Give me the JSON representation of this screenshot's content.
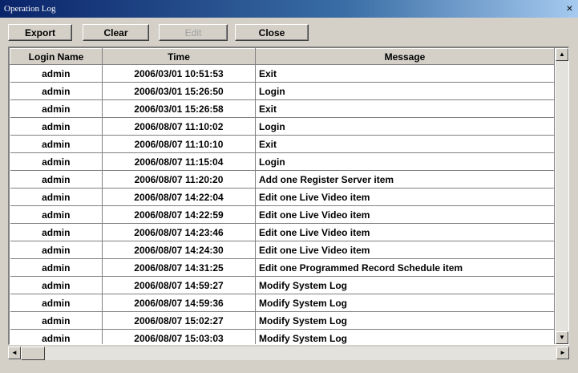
{
  "window": {
    "title": "Operation Log",
    "close_glyph": "×"
  },
  "toolbar": {
    "export_label": "Export",
    "clear_label": "Clear",
    "edit_label": "Edit",
    "close_label": "Close"
  },
  "table": {
    "headers": [
      "Login Name",
      "Time",
      "Message"
    ],
    "rows": [
      [
        "admin",
        "2006/03/01 10:51:53",
        "Exit"
      ],
      [
        "admin",
        "2006/03/01 15:26:50",
        "Login"
      ],
      [
        "admin",
        "2006/03/01 15:26:58",
        "Exit"
      ],
      [
        "admin",
        "2006/08/07 11:10:02",
        "Login"
      ],
      [
        "admin",
        "2006/08/07 11:10:10",
        "Exit"
      ],
      [
        "admin",
        "2006/08/07 11:15:04",
        "Login"
      ],
      [
        "admin",
        "2006/08/07 11:20:20",
        "Add one Register Server item"
      ],
      [
        "admin",
        "2006/08/07 14:22:04",
        "Edit  one Live Video item"
      ],
      [
        "admin",
        "2006/08/07 14:22:59",
        "Edit  one Live Video item"
      ],
      [
        "admin",
        "2006/08/07 14:23:46",
        "Edit  one Live Video item"
      ],
      [
        "admin",
        "2006/08/07 14:24:30",
        "Edit  one Live Video item"
      ],
      [
        "admin",
        "2006/08/07 14:31:25",
        "Edit one Programmed Record Schedule item"
      ],
      [
        "admin",
        "2006/08/07 14:59:27",
        "Modify System Log"
      ],
      [
        "admin",
        "2006/08/07 14:59:36",
        "Modify System Log"
      ],
      [
        "admin",
        "2006/08/07 15:02:27",
        "Modify System Log"
      ],
      [
        "admin",
        "2006/08/07 15:03:03",
        "Modify System Log"
      ]
    ]
  },
  "scroll": {
    "up": "▲",
    "down": "▼",
    "left": "◄",
    "right": "►"
  }
}
